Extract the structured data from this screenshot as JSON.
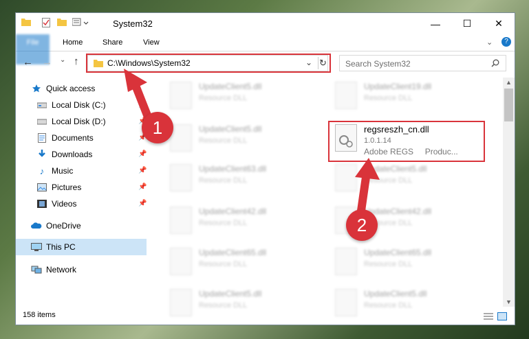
{
  "window": {
    "title": "System32",
    "minimize": "—",
    "maximize": "☐",
    "close": "✕"
  },
  "ribbon": {
    "file": "File",
    "home": "Home",
    "share": "Share",
    "view": "View",
    "help": "?"
  },
  "address": {
    "path": "C:\\Windows\\System32"
  },
  "search": {
    "placeholder": "Search System32"
  },
  "sidebar": {
    "quick_access": "Quick access",
    "items": [
      "Local Disk (C:)",
      "Local Disk (D:)",
      "Documents",
      "Downloads",
      "Music",
      "Pictures",
      "Videos"
    ],
    "onedrive": "OneDrive",
    "this_pc": "This PC",
    "network": "Network"
  },
  "files_left": [
    {
      "name": "UpdateClient5.dll",
      "desc": "Resource DLL"
    },
    {
      "name": "UpdateClient5.dll",
      "desc": "Resource DLL"
    },
    {
      "name": "UpdateClient63.dll",
      "desc": "Resource DLL"
    },
    {
      "name": "UpdateClient42.dll",
      "desc": "Resource DLL"
    },
    {
      "name": "UpdateClient65.dll",
      "desc": "Resource DLL"
    },
    {
      "name": "UpdateClient5.dll",
      "desc": "Resource DLL"
    }
  ],
  "files_right": [
    {
      "name": "UpdateClient19.dll",
      "desc": "Resource DLL"
    },
    {
      "name": "UpdateClient5.dll",
      "desc": "Resource DLL"
    },
    {
      "name": "UpdateClient42.dll",
      "desc": "Resource DLL"
    },
    {
      "name": "UpdateClient65.dll",
      "desc": "Resource DLL"
    },
    {
      "name": "UpdateClient5.dll",
      "desc": "Resource DLL"
    }
  ],
  "selected_file": {
    "name": "regsreszh_cn.dll",
    "version": "1.0.1.14",
    "company": "Adobe REGS     Produc..."
  },
  "status": {
    "count": "158 items"
  },
  "annotations": {
    "one": "1",
    "two": "2"
  },
  "colors": {
    "accent": "#1979ca",
    "highlight": "#d9333a"
  }
}
